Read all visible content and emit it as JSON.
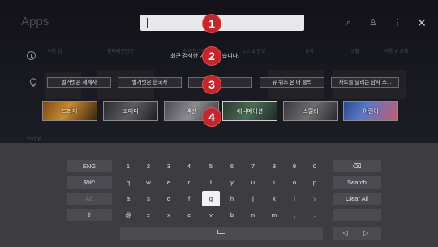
{
  "app_title": "Apps",
  "search": {
    "value": ""
  },
  "top_icons": [
    "search-icon",
    "profile-icon",
    "more-icon",
    "close-icon"
  ],
  "nav_tabs": [
    "추천 앱",
    "엔터테인먼트",
    "라이프스타일",
    "뉴스 & 정보",
    "교육",
    "생활",
    "여행 & 교육"
  ],
  "history": {
    "message": "최근 검색한 기록이 없습니다."
  },
  "keywords": [
    "벌거벗은 세계사",
    "벌거벗은 한국사",
    "",
    "유 퀴즈 온 더 블럭",
    "차트를 달리는 남자 스..."
  ],
  "genres": [
    "드라마",
    "코미디",
    "액션",
    "애니메이션",
    "스릴러",
    "어린이"
  ],
  "section_label": "인기 앱",
  "callouts": [
    "1",
    "2",
    "3",
    "4"
  ],
  "keyboard": {
    "rows": [
      [
        "1",
        "2",
        "3",
        "4",
        "5",
        "6",
        "7",
        "8",
        "9",
        "0"
      ],
      [
        "q",
        "w",
        "e",
        "r",
        "t",
        "y",
        "u",
        "i",
        "o",
        "p"
      ],
      [
        "a",
        "s",
        "d",
        "f",
        "g",
        "h",
        "j",
        "k",
        "l",
        "?"
      ],
      [
        "@",
        "z",
        "x",
        "c",
        "v",
        "b",
        "n",
        "m",
        ",",
        "."
      ]
    ],
    "left_keys": [
      "ENG",
      "$%^",
      "Àà",
      "⇧"
    ],
    "right_keys": [
      "⌫",
      "Search",
      "Clear All",
      ""
    ],
    "selected_key": "g",
    "arrows": [
      "◁",
      "▷"
    ]
  }
}
